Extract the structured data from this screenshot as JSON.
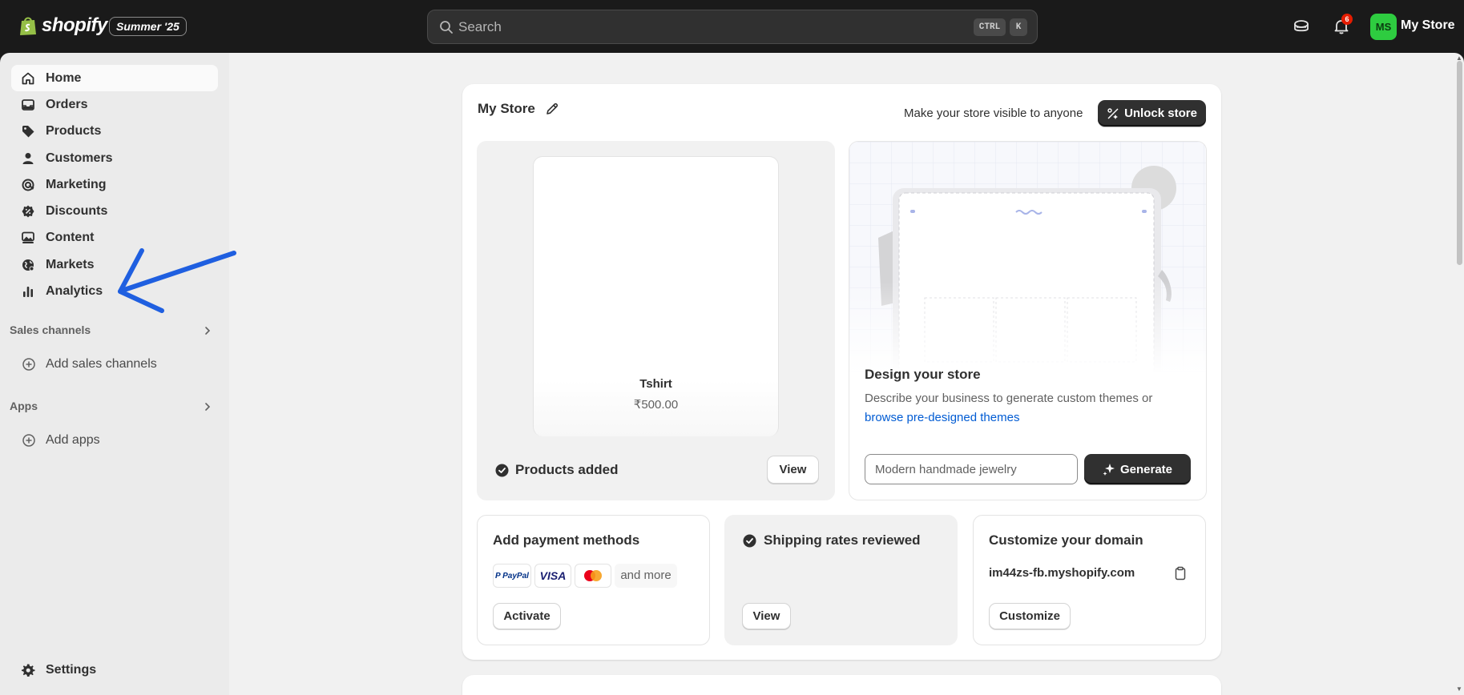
{
  "topbar": {
    "brand": "shopify",
    "edition": "Summer '25",
    "search_placeholder": "Search",
    "shortcut_ctrl": "CTRL",
    "shortcut_key": "K",
    "notification_count": "6",
    "avatar_initials": "MS",
    "store_name": "My Store"
  },
  "sidebar": {
    "items": [
      {
        "label": "Home",
        "icon": "home-icon"
      },
      {
        "label": "Orders",
        "icon": "inbox-icon"
      },
      {
        "label": "Products",
        "icon": "tag-icon"
      },
      {
        "label": "Customers",
        "icon": "person-icon"
      },
      {
        "label": "Marketing",
        "icon": "target-icon"
      },
      {
        "label": "Discounts",
        "icon": "discount-icon"
      },
      {
        "label": "Content",
        "icon": "image-icon"
      },
      {
        "label": "Markets",
        "icon": "globe-icon"
      },
      {
        "label": "Analytics",
        "icon": "bar-chart-icon"
      }
    ],
    "sales_channels": {
      "title": "Sales channels",
      "add_label": "Add sales channels"
    },
    "apps": {
      "title": "Apps",
      "add_label": "Add apps"
    },
    "settings_label": "Settings"
  },
  "main": {
    "store_title": "My Store",
    "visibility_text": "Make your store visible to anyone",
    "unlock_label": "Unlock store",
    "product": {
      "name": "Tshirt",
      "price": "₹500.00"
    },
    "products_added_label": "Products added",
    "view_label": "View",
    "design": {
      "title": "Design your store",
      "description": "Describe your business to generate custom themes or",
      "link": "browse pre-designed themes",
      "input_placeholder": "Modern handmade jewelry",
      "generate_label": "Generate"
    },
    "payment": {
      "title": "Add payment methods",
      "methods": [
        "PayPal",
        "VISA",
        "Mastercard"
      ],
      "more_label": "and more",
      "activate_label": "Activate"
    },
    "shipping": {
      "title": "Shipping rates reviewed",
      "view_label": "View"
    },
    "domain": {
      "title": "Customize your domain",
      "url": "im44zs-fb.myshopify.com",
      "customize_label": "Customize"
    }
  },
  "colors": {
    "topbar": "#1a1a1a",
    "sidebar": "#ebebeb",
    "main": "#f1f1f1",
    "link": "#005bd3",
    "avatar": "#2ecc40",
    "annotation_arrow": "#1f5fe0"
  }
}
